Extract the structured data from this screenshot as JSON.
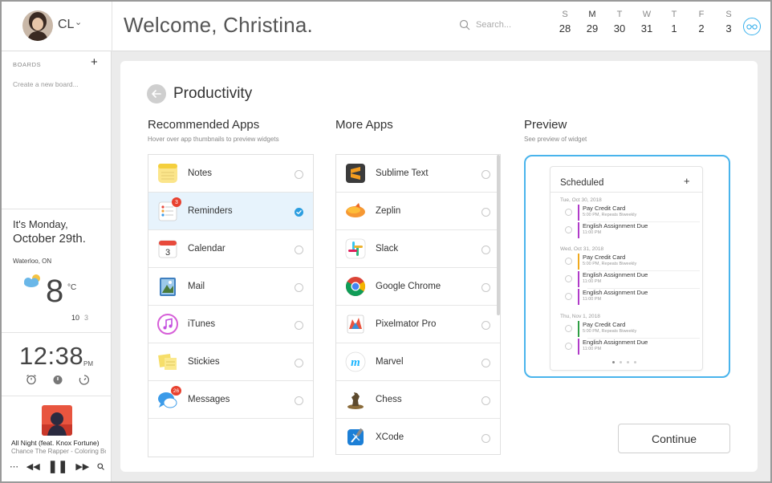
{
  "header": {
    "user_initials": "CL",
    "welcome": "Welcome, Christina.",
    "search_placeholder": "Search...",
    "week": [
      {
        "letter": "S",
        "num": "28"
      },
      {
        "letter": "M",
        "num": "29"
      },
      {
        "letter": "T",
        "num": "30"
      },
      {
        "letter": "W",
        "num": "31"
      },
      {
        "letter": "T",
        "num": "1"
      },
      {
        "letter": "F",
        "num": "2"
      },
      {
        "letter": "S",
        "num": "3"
      }
    ]
  },
  "sidebar": {
    "boards_label": "BOARDS",
    "boards_add": "+",
    "create_board": "Create a new board...",
    "date_line1": "It's Monday,",
    "date_line2": "October 29th.",
    "location": "Waterloo, ON",
    "temperature": "8",
    "temp_unit": "°C",
    "temp_high": "10",
    "temp_low": "3",
    "clock": "12:38",
    "clock_ampm": "PM",
    "track_title": "All Night (feat. Knox Fortune)",
    "track_artist": "Chance The Rapper - Coloring Book"
  },
  "panel": {
    "title": "Productivity",
    "recommended": {
      "title": "Recommended Apps",
      "subtitle": "Hover over app thumbnails to preview widgets",
      "apps": [
        {
          "name": "Notes",
          "selected": false
        },
        {
          "name": "Reminders",
          "selected": true,
          "badge": "3"
        },
        {
          "name": "Calendar",
          "selected": false
        },
        {
          "name": "Mail",
          "selected": false
        },
        {
          "name": "iTunes",
          "selected": false
        },
        {
          "name": "Stickies",
          "selected": false
        },
        {
          "name": "Messages",
          "selected": false,
          "badge": "26"
        }
      ]
    },
    "more": {
      "title": "More Apps",
      "apps": [
        {
          "name": "Sublime Text"
        },
        {
          "name": "Zeplin"
        },
        {
          "name": "Slack"
        },
        {
          "name": "Google Chrome"
        },
        {
          "name": "Pixelmator Pro"
        },
        {
          "name": "Marvel"
        },
        {
          "name": "Chess"
        },
        {
          "name": "XCode"
        }
      ]
    },
    "preview": {
      "title": "Preview",
      "subtitle": "See preview of widget",
      "widget_title": "Scheduled",
      "widget_add": "+",
      "groups": [
        {
          "date": "Tue, Oct 30, 2018",
          "items": [
            {
              "name": "Pay Credit Card",
              "meta": "5:00 PM, Repeats Biweekly",
              "color": "#b03bc9"
            },
            {
              "name": "English Assignment Due",
              "meta": "11:00 PM",
              "color": "#b03bc9"
            }
          ]
        },
        {
          "date": "Wed, Oct 31, 2018",
          "items": [
            {
              "name": "Pay Credit Card",
              "meta": "5:00 PM, Repeats Biweekly",
              "color": "#f0a91e"
            },
            {
              "name": "English Assignment Due",
              "meta": "11:00 PM",
              "color": "#b03bc9"
            },
            {
              "name": "English Assignment Due",
              "meta": "11:00 PM",
              "color": "#b03bc9"
            }
          ]
        },
        {
          "date": "Thu, Nov 1, 2018",
          "items": [
            {
              "name": "Pay Credit Card",
              "meta": "5:00 PM, Repeats Biweekly",
              "color": "#2f9e44"
            },
            {
              "name": "English Assignment Due",
              "meta": "11:00 PM",
              "color": "#b03bc9"
            }
          ]
        }
      ]
    },
    "continue_label": "Continue"
  },
  "colors": {
    "accent": "#2c9ee0",
    "preview_border": "#49b4ec",
    "selected_row": "#e7f3fc"
  },
  "icons": {
    "notes": "notes-icon",
    "reminders": "reminders-icon",
    "calendar": "calendar-icon",
    "mail": "mail-icon",
    "itunes": "itunes-icon",
    "stickies": "stickies-icon",
    "messages": "messages-icon",
    "sublime": "sublime-text-icon",
    "zeplin": "zeplin-icon",
    "slack": "slack-icon",
    "chrome": "google-chrome-icon",
    "pixelmator": "pixelmator-pro-icon",
    "marvel": "marvel-icon",
    "chess": "chess-icon",
    "xcode": "xcode-icon"
  }
}
